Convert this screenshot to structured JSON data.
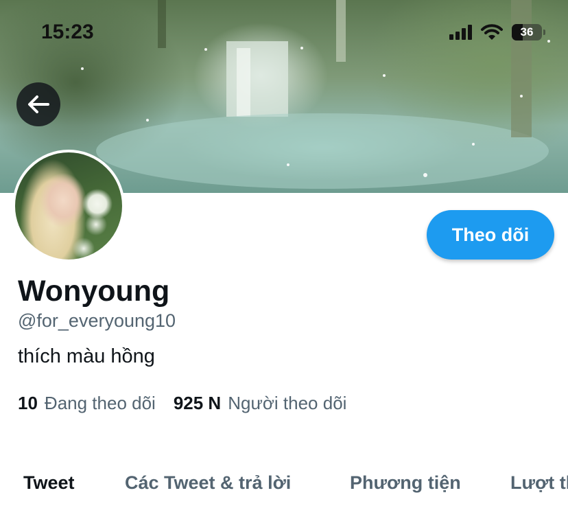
{
  "status_bar": {
    "time": "15:23",
    "battery_level": "36",
    "signal_icon": "cellular-signal-icon",
    "wifi_icon": "wifi-icon"
  },
  "header": {
    "back_icon": "arrow-left-icon"
  },
  "profile": {
    "follow_label": "Theo dõi",
    "name": "Wonyoung",
    "handle": "@for_everyoung10",
    "bio": "thích màu hồng",
    "following_count": "10",
    "following_label": "Đang theo dõi",
    "followers_count": "925 N",
    "followers_label": "Người theo dõi"
  },
  "tabs": [
    {
      "label": "Tweet",
      "active": true
    },
    {
      "label": "Các Tweet & trả lời",
      "active": false
    },
    {
      "label": "Phương tiện",
      "active": false
    },
    {
      "label": "Lượt thích",
      "active": false
    }
  ],
  "colors": {
    "accent": "#1d9bf0",
    "text_primary": "#0f1419",
    "text_secondary": "#536471"
  }
}
